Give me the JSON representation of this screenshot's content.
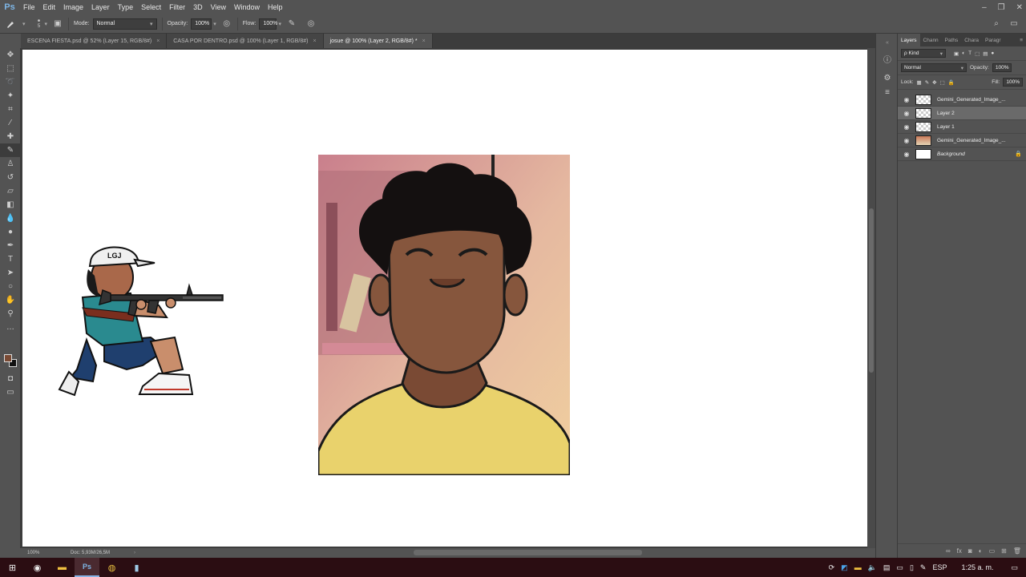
{
  "app": {
    "logo": "Ps"
  },
  "menu": [
    "File",
    "Edit",
    "Image",
    "Layer",
    "Type",
    "Select",
    "Filter",
    "3D",
    "View",
    "Window",
    "Help"
  ],
  "options": {
    "brush_size": "5",
    "mode_label": "Mode:",
    "mode_value": "Normal",
    "opacity_label": "Opacity:",
    "opacity_value": "100%",
    "flow_label": "Flow:",
    "flow_value": "100%"
  },
  "tabs": [
    {
      "label": "ESCENA FIESTA.psd @ 52% (Layer 15, RGB/8#)",
      "close": "×"
    },
    {
      "label": "CASA POR DENTRO.psd @ 100% (Layer 1, RGB/8#)",
      "close": "×"
    },
    {
      "label": "josue @ 100% (Layer 2, RGB/8#) *",
      "close": "×"
    }
  ],
  "status": {
    "zoom": "100%",
    "doc": "Doc: 5,93M/26,5M"
  },
  "layers_panel": {
    "tabs": [
      "Layers",
      "Chann",
      "Paths",
      "Chara",
      "Paragr"
    ],
    "filter_label": "ρ Kind",
    "blend_mode": "Normal",
    "opacity_label": "Opacity:",
    "opacity_value": "100%",
    "lock_label": "Lock:",
    "fill_label": "Fill:",
    "fill_value": "100%",
    "layers": [
      {
        "name": "Gemini_Generated_Image_...",
        "selected": false,
        "italic": false
      },
      {
        "name": "Layer 2",
        "selected": true,
        "italic": false
      },
      {
        "name": "Layer 1",
        "selected": false,
        "italic": false
      },
      {
        "name": "Gemini_Generated_Image_...",
        "selected": false,
        "italic": false
      },
      {
        "name": "Background",
        "selected": false,
        "italic": true
      }
    ]
  },
  "taskbar": {
    "language": "ESP",
    "time": "1:25 a. m."
  },
  "colors": {
    "foreground": "#7a4a34",
    "background": "#111111",
    "taskbar": "#2b0d12"
  },
  "icons": {
    "tools": [
      "move-icon",
      "marquee-icon",
      "lasso-icon",
      "magic-wand-icon",
      "crop-icon",
      "eyedropper-icon",
      "healing-icon",
      "brush-icon",
      "stamp-icon",
      "history-brush-icon",
      "eraser-icon",
      "gradient-icon",
      "blur-icon",
      "dodge-icon",
      "pen-icon",
      "type-icon",
      "path-select-icon",
      "shape-icon",
      "hand-icon",
      "zoom-icon",
      "more-tools-icon"
    ]
  }
}
